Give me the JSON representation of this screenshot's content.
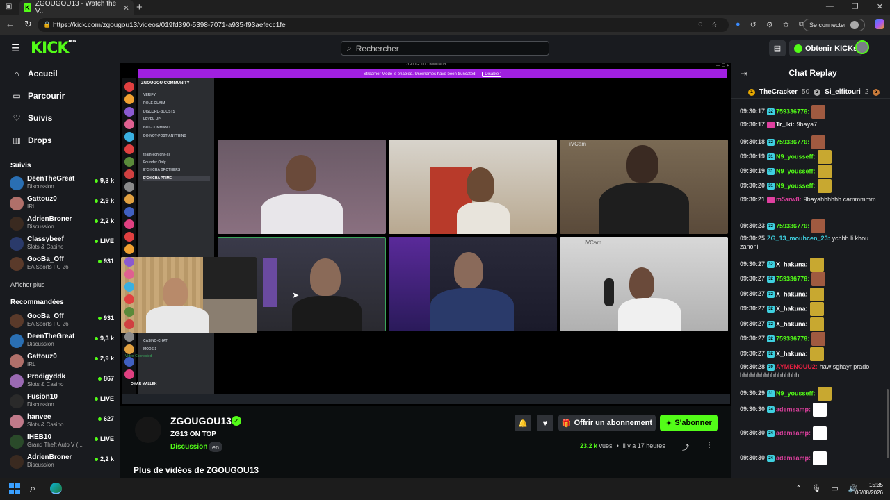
{
  "browser": {
    "tab_title": "ZGOUGOU13 - Watch the V...",
    "url": "https://kick.com/zgougou13/videos/019fd390-5398-7071-a935-f93aefecc1fe",
    "signin_label": "Se connecter"
  },
  "header": {
    "logo": "KICK",
    "logo_badge": "BETA",
    "search_placeholder": "Rechercher",
    "get_kicks_label": "Obtenir KICKs"
  },
  "sidebar": {
    "nav": [
      {
        "label": "Accueil",
        "icon": "home-icon"
      },
      {
        "label": "Parcourir",
        "icon": "browse-icon"
      },
      {
        "label": "Suivis",
        "icon": "heart-icon"
      },
      {
        "label": "Drops",
        "icon": "drops-icon"
      }
    ],
    "followed_title": "Suivis",
    "followed": [
      {
        "name": "DeenTheGreat",
        "category": "Discussion",
        "viewers": "9,3 k",
        "color": "#2a6fb3"
      },
      {
        "name": "Gattouz0",
        "category": "IRL",
        "viewers": "2,9 k",
        "color": "#b0706a"
      },
      {
        "name": "AdrienBroner",
        "category": "Discussion",
        "viewers": "2,2 k",
        "color": "#3a2a20"
      },
      {
        "name": "Classybeef",
        "category": "Slots & Casino",
        "viewers": "LIVE",
        "color": "#2a3a6a"
      },
      {
        "name": "GooBa_Off",
        "category": "EA Sports FC 26",
        "viewers": "931",
        "color": "#5a3a2a"
      }
    ],
    "show_more": "Afficher plus",
    "recommended_title": "Recommandées",
    "recommended": [
      {
        "name": "GooBa_Off",
        "category": "EA Sports FC 26",
        "viewers": "931",
        "color": "#5a3a2a"
      },
      {
        "name": "DeenTheGreat",
        "category": "Discussion",
        "viewers": "9,3 k",
        "color": "#2a6fb3"
      },
      {
        "name": "Gattouz0",
        "category": "IRL",
        "viewers": "2,9 k",
        "color": "#b0706a"
      },
      {
        "name": "Prodigyddk",
        "category": "Slots & Casino",
        "viewers": "867",
        "color": "#9a6ab3"
      },
      {
        "name": "Fusion10",
        "category": "Discussion",
        "viewers": "LIVE",
        "color": "#2a2a2a"
      },
      {
        "name": "hanvee",
        "category": "Slots & Casino",
        "viewers": "627",
        "color": "#c07a8a"
      },
      {
        "name": "IHEB10",
        "category": "Grand Theft Auto V (...",
        "viewers": "LIVE",
        "color": "#2a4a2a"
      },
      {
        "name": "AdrienBroner",
        "category": "Discussion",
        "viewers": "2,2 k",
        "color": "#3a2a20"
      }
    ]
  },
  "video": {
    "discord_title": "ZGOUGOU COMMUNITY",
    "streamer_banner": "Streamer Mode is enabled. Usernames have been truncated.",
    "disable_label": "Disable",
    "server_name": "ZGOUGOU COMMUNITY",
    "channels": [
      "VERIFY",
      "ROLE-CLAIM",
      "DISCORD-BOOSTS",
      "LEVEL-UP",
      "BOT-COMMAND",
      "DO-NOT-POST-ANYTHING",
      "team-echicha-ss",
      "Founder Only",
      "E'CHICHA BROTHERS",
      "E'CHICHA PRIME",
      "CASINO-CHAT",
      "MODS 1"
    ],
    "voice_user": "OMAR MALLEK",
    "voice_status": "Video Connected"
  },
  "channel": {
    "name": "ZGOUGOU13",
    "video_title": "ZG13 ON TOP",
    "category": "Discussion",
    "language": "en",
    "follow_icon": "bell-icon",
    "gift_label": "Offrir un abonnement",
    "subscribe_label": "S'abonner",
    "views_value": "23,2 k",
    "views_label": "vues",
    "posted": "il y a 17 heures",
    "more_videos": "Plus de vidéos de ZGOUGOU13"
  },
  "chat": {
    "title": "Chat Replay",
    "leaderboard": [
      {
        "rank": "1",
        "name": "TheCracker",
        "count": "50"
      },
      {
        "rank": "2",
        "name": "Si_elfitouri",
        "count": "2"
      },
      {
        "rank": "3",
        "name": "",
        "count": ""
      }
    ],
    "messages": [
      {
        "time": "09:30:17",
        "badge": "32",
        "badge_color": "#3fd0e0",
        "user": "759336776:",
        "user_color": "#53fc18",
        "text": "",
        "emote": "#a05a40"
      },
      {
        "time": "09:30:17",
        "badge": "",
        "badge_color": "#e040a0",
        "user": "Tr_lki:",
        "user_color": "#ffffff",
        "text": "9baya7",
        "emote": ""
      },
      {
        "time": "09:30:18",
        "badge": "32",
        "badge_color": "#3fd0e0",
        "user": "759336776:",
        "user_color": "#53fc18",
        "text": "",
        "emote": "#a05a40"
      },
      {
        "time": "09:30:19",
        "badge": "31",
        "badge_color": "#3fd0e0",
        "user": "N9_yousseff:",
        "user_color": "#53fc18",
        "text": "",
        "emote": "#c8a830"
      },
      {
        "time": "09:30:19",
        "badge": "31",
        "badge_color": "#3fd0e0",
        "user": "N9_yousseff:",
        "user_color": "#53fc18",
        "text": "",
        "emote": "#c8a830"
      },
      {
        "time": "09:30:20",
        "badge": "31",
        "badge_color": "#3fd0e0",
        "user": "N9_yousseff:",
        "user_color": "#53fc18",
        "text": "",
        "emote": "#c8a830"
      },
      {
        "time": "09:30:21",
        "badge": "",
        "badge_color": "#e040a0",
        "user": "m5arw8:",
        "user_color": "#e040a0",
        "text": "9bayahhhhhh cammmmm",
        "emote": ""
      },
      {
        "time": "09:30:23",
        "badge": "32",
        "badge_color": "#3fd0e0",
        "user": "759336776:",
        "user_color": "#53fc18",
        "text": "",
        "emote": "#a05a40"
      },
      {
        "time": "09:30:25",
        "badge": "",
        "badge_color": "",
        "user": "ZG_13_mouhcen_23:",
        "user_color": "#3fd0e0",
        "text": "ychbh li khou zanoni",
        "emote": ""
      },
      {
        "time": "09:30:27",
        "badge": "32",
        "badge_color": "#3fd0e0",
        "user": "X_hakuna:",
        "user_color": "#ffffff",
        "text": "",
        "emote": "#c8a830"
      },
      {
        "time": "09:30:27",
        "badge": "32",
        "badge_color": "#3fd0e0",
        "user": "759336776:",
        "user_color": "#53fc18",
        "text": "",
        "emote": "#a05a40"
      },
      {
        "time": "09:30:27",
        "badge": "32",
        "badge_color": "#3fd0e0",
        "user": "X_hakuna:",
        "user_color": "#ffffff",
        "text": "",
        "emote": "#c8a830"
      },
      {
        "time": "09:30:27",
        "badge": "32",
        "badge_color": "#3fd0e0",
        "user": "X_hakuna:",
        "user_color": "#ffffff",
        "text": "",
        "emote": "#c8a830"
      },
      {
        "time": "09:30:27",
        "badge": "32",
        "badge_color": "#3fd0e0",
        "user": "X_hakuna:",
        "user_color": "#ffffff",
        "text": "",
        "emote": "#c8a830"
      },
      {
        "time": "09:30:27",
        "badge": "32",
        "badge_color": "#3fd0e0",
        "user": "759336776:",
        "user_color": "#53fc18",
        "text": "",
        "emote": "#a05a40"
      },
      {
        "time": "09:30:27",
        "badge": "32",
        "badge_color": "#3fd0e0",
        "user": "X_hakuna:",
        "user_color": "#ffffff",
        "text": "",
        "emote": "#c8a830"
      },
      {
        "time": "09:30:28",
        "badge": "30",
        "badge_color": "#3fd0e0",
        "user": "AYMENOUU2:",
        "user_color": "#e02040",
        "text": "haw sghayr prado hhhhhhhhhhhhhhhhh",
        "emote": ""
      },
      {
        "time": "09:30:29",
        "badge": "31",
        "badge_color": "#3fd0e0",
        "user": "N9_yousseff:",
        "user_color": "#53fc18",
        "text": "",
        "emote": "#c8a830"
      },
      {
        "time": "09:30:30",
        "badge": "24",
        "badge_color": "#3fd0e0",
        "user": "ademsamp:",
        "user_color": "#e040a0",
        "text": "",
        "emote": "#ffffff"
      },
      {
        "time": "09:30:30",
        "badge": "24",
        "badge_color": "#3fd0e0",
        "user": "ademsamp:",
        "user_color": "#e040a0",
        "text": "",
        "emote": "#ffffff"
      },
      {
        "time": "09:30:30",
        "badge": "24",
        "badge_color": "#3fd0e0",
        "user": "ademsamp:",
        "user_color": "#e040a0",
        "text": "",
        "emote": "#ffffff"
      }
    ]
  },
  "taskbar": {
    "time": "15:35",
    "date": "06/08/2026"
  }
}
